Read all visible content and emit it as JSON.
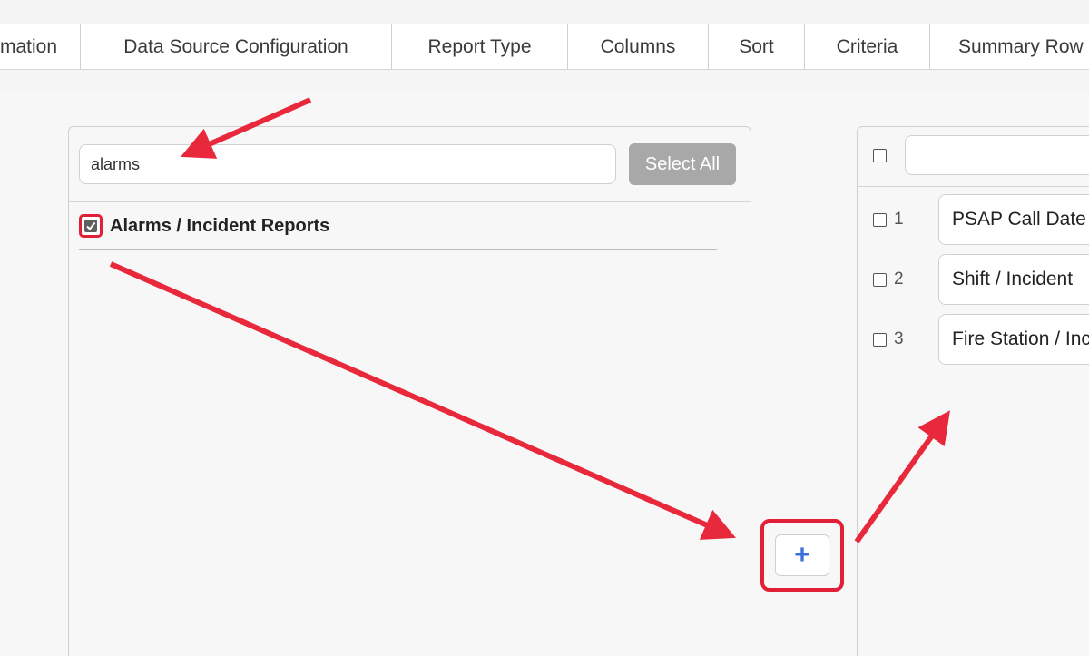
{
  "tabs": [
    {
      "label": "mation"
    },
    {
      "label": "Data Source Configuration"
    },
    {
      "label": "Report Type"
    },
    {
      "label": "Columns"
    },
    {
      "label": "Sort"
    },
    {
      "label": "Criteria"
    },
    {
      "label": "Summary Row"
    }
  ],
  "left_panel": {
    "search_value": "alarms",
    "select_all_label": "Select All",
    "result_label": "Alarms / Incident Reports",
    "result_checked": true
  },
  "add_button": {
    "label": "+"
  },
  "right_panel": {
    "columns": [
      {
        "num": "1",
        "label": "PSAP Call Date"
      },
      {
        "num": "2",
        "label": "Shift / Incident"
      },
      {
        "num": "3",
        "label": "Fire Station / Incident"
      }
    ]
  },
  "colors": {
    "highlight": "#e11f36",
    "accent_plus": "#3b6fe0",
    "select_all_bg": "#a8a8a8"
  }
}
